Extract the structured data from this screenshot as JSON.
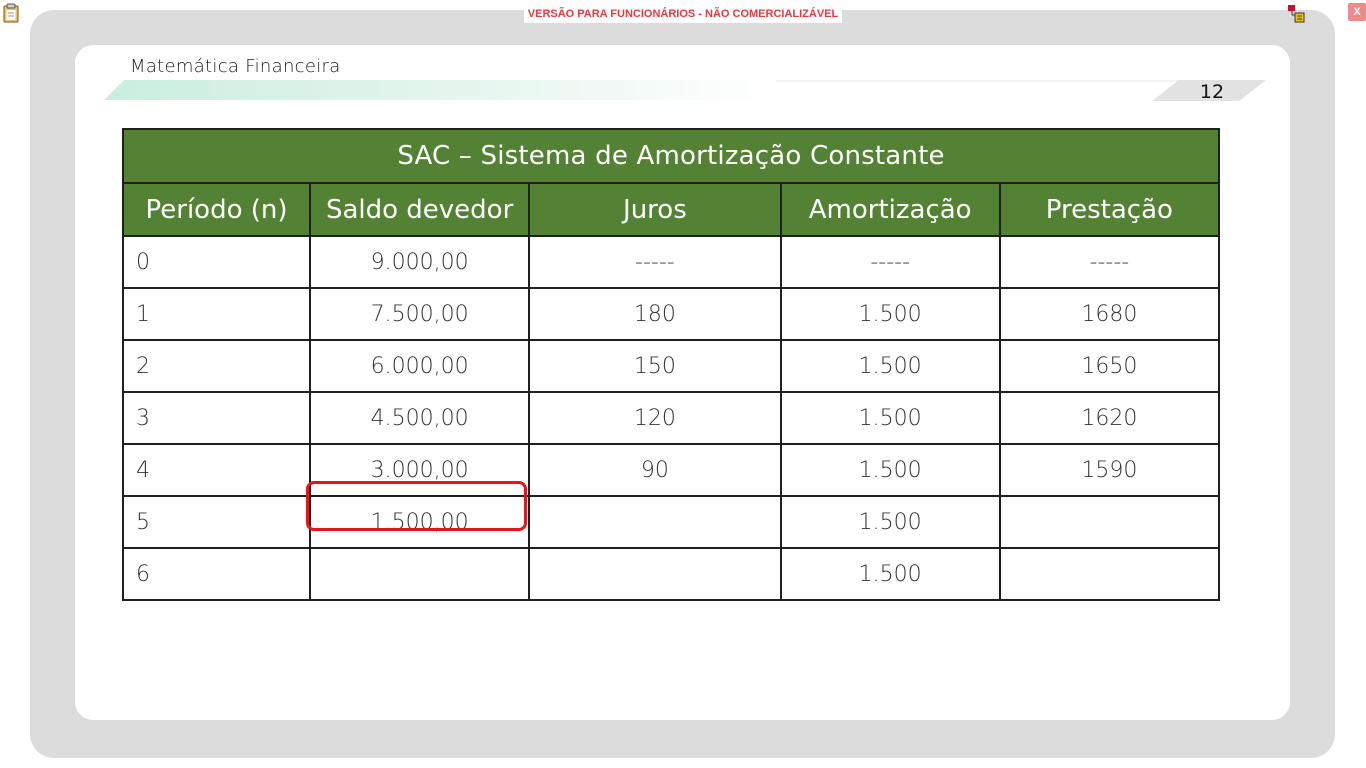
{
  "banner": {
    "text": "VERSÃO PARA FUNCIONÁRIOS - NÃO COMERCIALIZÁVEL"
  },
  "window": {
    "close_label": "X"
  },
  "slide": {
    "title": "Matemática Financeira",
    "page_number": "12"
  },
  "table": {
    "caption": "SAC – Sistema de Amortização Constante",
    "headers": [
      "Período (n)",
      "Saldo devedor",
      "Juros",
      "Amortização",
      "Prestação"
    ],
    "rows": [
      [
        "0",
        "9.000,00",
        "-----",
        "-----",
        "-----"
      ],
      [
        "1",
        "7.500,00",
        "180",
        "1.500",
        "1680"
      ],
      [
        "2",
        "6.000,00",
        "150",
        "1.500",
        "1650"
      ],
      [
        "3",
        "4.500,00",
        "120",
        "1.500",
        "1620"
      ],
      [
        "4",
        "3.000,00",
        "90",
        "1.500",
        "1590"
      ],
      [
        "5",
        "1.500,00",
        "",
        "1.500",
        ""
      ],
      [
        "6",
        "",
        "",
        "1.500",
        ""
      ]
    ]
  },
  "colors": {
    "header_green": "#548235",
    "highlight_red": "#e8141b",
    "banner_red": "#e8383d"
  },
  "icons": [
    "clipboard-icon",
    "network-icon",
    "close-icon"
  ]
}
